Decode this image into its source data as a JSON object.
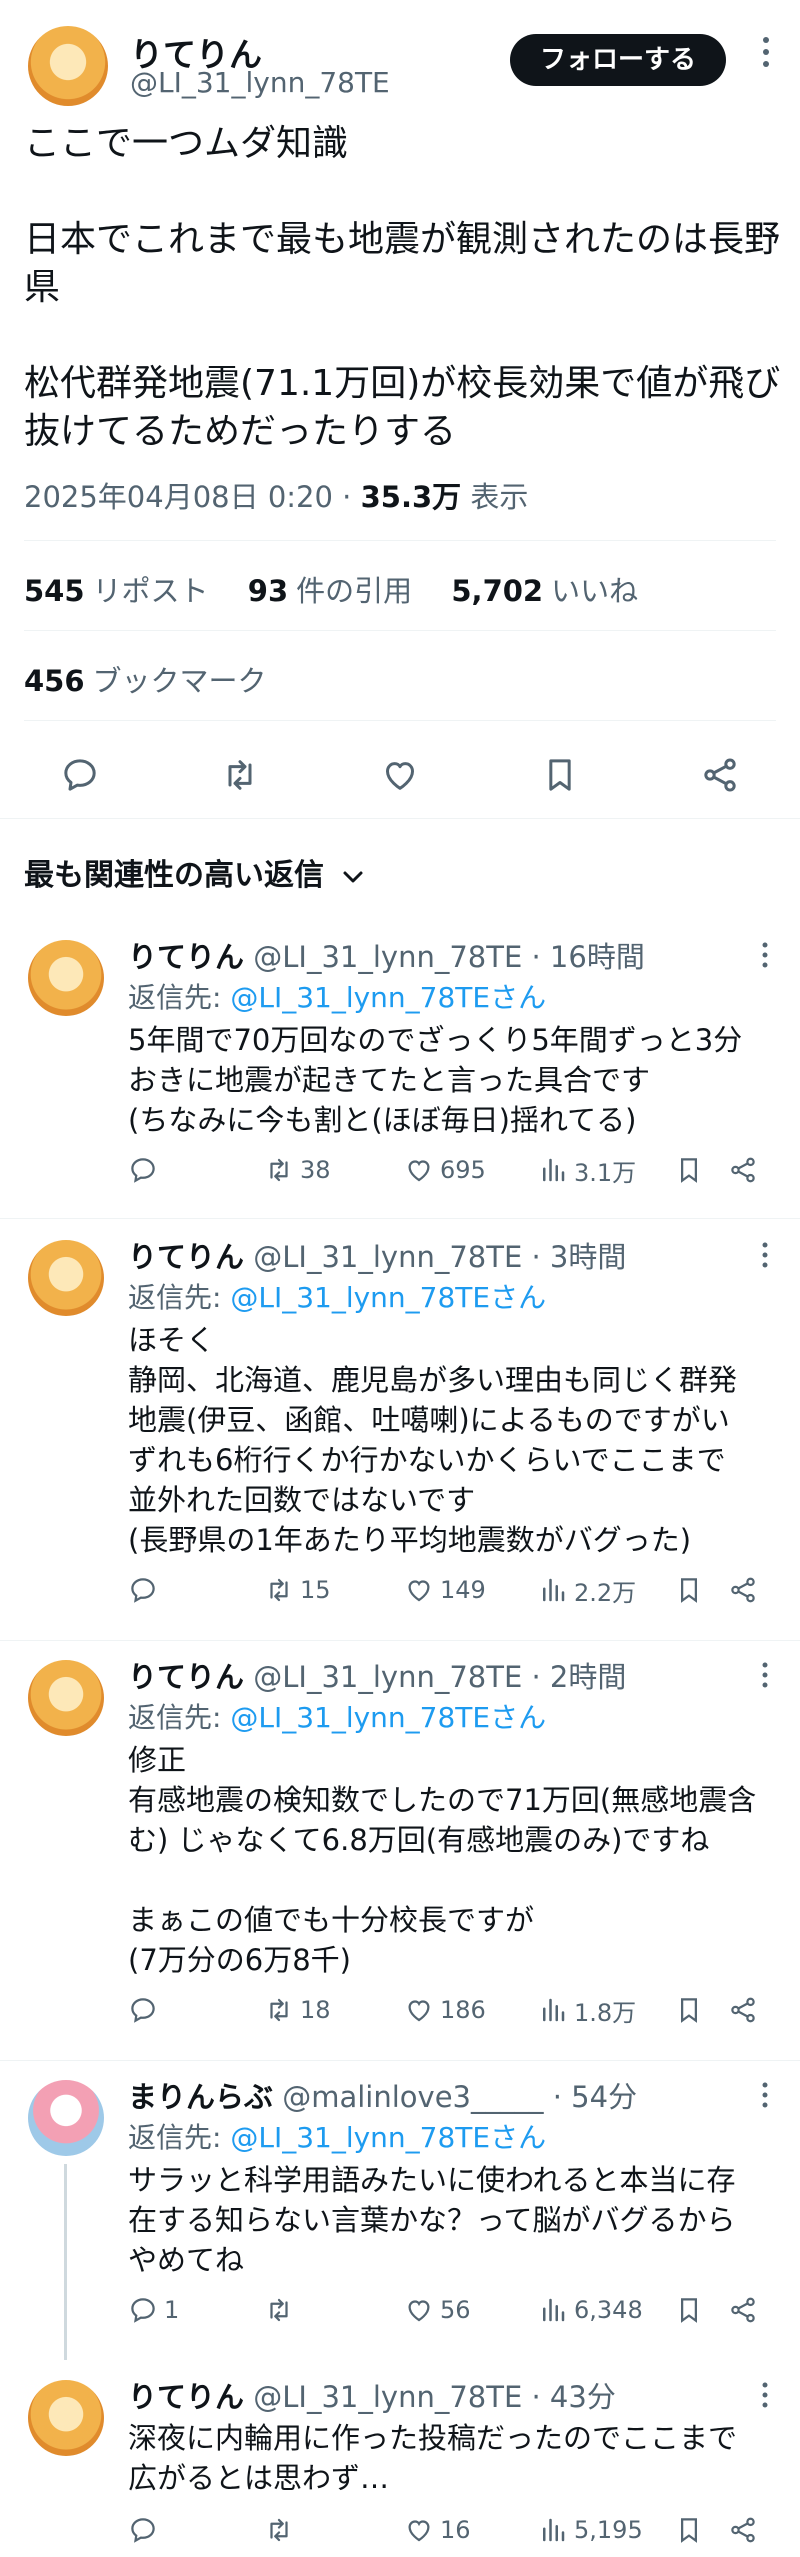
{
  "main_post": {
    "author_name": "りてりん",
    "handle": "@LI_31_lynn_78TE",
    "follow_label": "フォローする",
    "paragraphs": [
      "ここで一つムダ知識",
      "日本でこれまで最も地震が観測されたのは長野県",
      "松代群発地震(71.1万回)が校長効果で値が飛び抜けてるためだったりする"
    ],
    "timestamp": "2025年04月08日 0:20 · ",
    "views_value": "35.3万",
    "views_label": " 表示",
    "reposts_value": "545",
    "reposts_label": "リポスト",
    "quotes_value": "93",
    "quotes_label": "件の引用",
    "likes_value": "5,702",
    "likes_label": "いいね",
    "bookmarks_value": "456",
    "bookmarks_label": "ブックマーク"
  },
  "sort_label": "最も関連性の高い返信",
  "replies": [
    {
      "name": "りてりん",
      "handle": "@LI_31_lynn_78TE",
      "time": " · 16時間",
      "reply_to_label": "返信先: ",
      "reply_to_link": "@LI_31_lynn_78TEさん",
      "lines": [
        "5年間で70万回なのでざっくり5年間ずっと3分",
        "おきに地震が起きてたと言った具合です",
        "(ちなみに今も割と(ほぼ毎日)揺れてる)"
      ],
      "reposts": "38",
      "likes": "695",
      "views": "3.1万"
    },
    {
      "name": "りてりん",
      "handle": "@LI_31_lynn_78TE",
      "time": " · 3時間",
      "reply_to_label": "返信先: ",
      "reply_to_link": "@LI_31_lynn_78TEさん",
      "lines": [
        "ほそく",
        "静岡、北海道、鹿児島が多い理由も同じく群発",
        "地震(伊豆、函館、吐噶喇)によるものですがい",
        "ずれも6桁行くか行かないかくらいでここまで",
        "並外れた回数ではないです",
        "(長野県の1年あたり平均地震数がバグった)"
      ],
      "reposts": "15",
      "likes": "149",
      "views": "2.2万"
    },
    {
      "name": "りてりん",
      "handle": "@LI_31_lynn_78TE",
      "time": " · 2時間",
      "reply_to_label": "返信先: ",
      "reply_to_link": "@LI_31_lynn_78TEさん",
      "lines": [
        "修正",
        "有感地震の検知数でしたので71万回(無感地震含",
        "む) じゃなくて6.8万回(有感地震のみ)ですね",
        "",
        "まぁこの値でも十分校長ですが",
        "(7万分の6万8千)"
      ],
      "reposts": "18",
      "likes": "186",
      "views": "1.8万"
    },
    {
      "name": "まりんらぶ",
      "handle": "@malinlove3_____",
      "time": " · 54分",
      "reply_to_label": "返信先: ",
      "reply_to_link": "@LI_31_lynn_78TEさん",
      "lines": [
        "サラッと科学用語みたいに使われると本当に存",
        "在する知らない言葉かな？って脳がバグるから",
        "やめてね"
      ],
      "replies_count": "1",
      "reposts": "",
      "likes": "56",
      "views": "6,348"
    },
    {
      "name": "りてりん",
      "handle": "@LI_31_lynn_78TE",
      "time": " · 43分",
      "lines": [
        "深夜に内輪用に作った投稿だったのでここまで",
        "広がるとは思わず…"
      ],
      "reposts": "",
      "likes": "16",
      "views": "5,195"
    }
  ]
}
